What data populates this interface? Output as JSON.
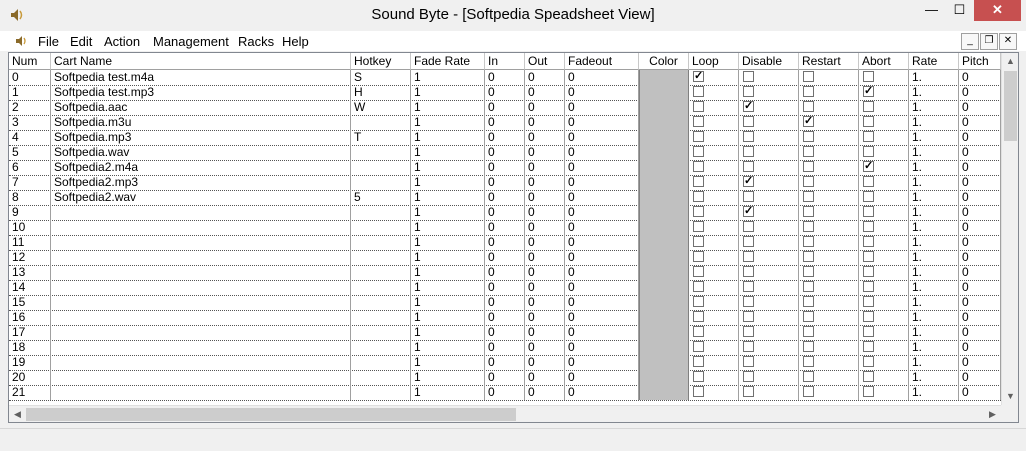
{
  "window": {
    "title": "Sound Byte - [Softpedia Speadsheet View]",
    "min": "—",
    "max": "☐",
    "close": "✕"
  },
  "menu": [
    "File",
    "Edit",
    "Action",
    "Management",
    "Racks",
    "Help"
  ],
  "mdi": {
    "min": "_",
    "restore": "❐",
    "close": "✕"
  },
  "columns": [
    "Num",
    "Cart Name",
    "Hotkey",
    "Fade Rate",
    "In",
    "Out",
    "Fadeout",
    "Color",
    "Loop",
    "Disable",
    "Restart",
    "Abort",
    "Rate",
    "Pitch"
  ],
  "rows": [
    {
      "num": "0",
      "name": "Softpedia test.m4a",
      "hotkey": "S",
      "fade": "1",
      "in": "0",
      "out": "0",
      "fadeout": "0",
      "loop": true,
      "disable": false,
      "restart": false,
      "abort": false,
      "rate": "1.",
      "pitch": "0"
    },
    {
      "num": "1",
      "name": "Softpedia test.mp3",
      "hotkey": "H",
      "fade": "1",
      "in": "0",
      "out": "0",
      "fadeout": "0",
      "loop": false,
      "disable": false,
      "restart": false,
      "abort": true,
      "rate": "1.",
      "pitch": "0"
    },
    {
      "num": "2",
      "name": "Softpedia.aac",
      "hotkey": "W",
      "fade": "1",
      "in": "0",
      "out": "0",
      "fadeout": "0",
      "loop": false,
      "disable": true,
      "restart": false,
      "abort": false,
      "rate": "1.",
      "pitch": "0"
    },
    {
      "num": "3",
      "name": "Softpedia.m3u",
      "hotkey": "",
      "fade": "1",
      "in": "0",
      "out": "0",
      "fadeout": "0",
      "loop": false,
      "disable": false,
      "restart": true,
      "abort": false,
      "rate": "1.",
      "pitch": "0"
    },
    {
      "num": "4",
      "name": "Softpedia.mp3",
      "hotkey": "T",
      "fade": "1",
      "in": "0",
      "out": "0",
      "fadeout": "0",
      "loop": false,
      "disable": false,
      "restart": false,
      "abort": false,
      "rate": "1.",
      "pitch": "0"
    },
    {
      "num": "5",
      "name": "Softpedia.wav",
      "hotkey": "",
      "fade": "1",
      "in": "0",
      "out": "0",
      "fadeout": "0",
      "loop": false,
      "disable": false,
      "restart": false,
      "abort": false,
      "rate": "1.",
      "pitch": "0"
    },
    {
      "num": "6",
      "name": "Softpedia2.m4a",
      "hotkey": "",
      "fade": "1",
      "in": "0",
      "out": "0",
      "fadeout": "0",
      "loop": false,
      "disable": false,
      "restart": false,
      "abort": true,
      "rate": "1.",
      "pitch": "0"
    },
    {
      "num": "7",
      "name": "Softpedia2.mp3",
      "hotkey": "",
      "fade": "1",
      "in": "0",
      "out": "0",
      "fadeout": "0",
      "loop": false,
      "disable": true,
      "restart": false,
      "abort": false,
      "rate": "1.",
      "pitch": "0"
    },
    {
      "num": "8",
      "name": "Softpedia2.wav",
      "hotkey": "5",
      "fade": "1",
      "in": "0",
      "out": "0",
      "fadeout": "0",
      "loop": false,
      "disable": false,
      "restart": false,
      "abort": false,
      "rate": "1.",
      "pitch": "0"
    },
    {
      "num": "9",
      "name": "",
      "hotkey": "",
      "fade": "1",
      "in": "0",
      "out": "0",
      "fadeout": "0",
      "loop": false,
      "disable": true,
      "restart": false,
      "abort": false,
      "rate": "1.",
      "pitch": "0"
    },
    {
      "num": "10",
      "name": "",
      "hotkey": "",
      "fade": "1",
      "in": "0",
      "out": "0",
      "fadeout": "0",
      "loop": false,
      "disable": false,
      "restart": false,
      "abort": false,
      "rate": "1.",
      "pitch": "0"
    },
    {
      "num": "11",
      "name": "",
      "hotkey": "",
      "fade": "1",
      "in": "0",
      "out": "0",
      "fadeout": "0",
      "loop": false,
      "disable": false,
      "restart": false,
      "abort": false,
      "rate": "1.",
      "pitch": "0"
    },
    {
      "num": "12",
      "name": "",
      "hotkey": "",
      "fade": "1",
      "in": "0",
      "out": "0",
      "fadeout": "0",
      "loop": false,
      "disable": false,
      "restart": false,
      "abort": false,
      "rate": "1.",
      "pitch": "0"
    },
    {
      "num": "13",
      "name": "",
      "hotkey": "",
      "fade": "1",
      "in": "0",
      "out": "0",
      "fadeout": "0",
      "loop": false,
      "disable": false,
      "restart": false,
      "abort": false,
      "rate": "1.",
      "pitch": "0"
    },
    {
      "num": "14",
      "name": "",
      "hotkey": "",
      "fade": "1",
      "in": "0",
      "out": "0",
      "fadeout": "0",
      "loop": false,
      "disable": false,
      "restart": false,
      "abort": false,
      "rate": "1.",
      "pitch": "0"
    },
    {
      "num": "15",
      "name": "",
      "hotkey": "",
      "fade": "1",
      "in": "0",
      "out": "0",
      "fadeout": "0",
      "loop": false,
      "disable": false,
      "restart": false,
      "abort": false,
      "rate": "1.",
      "pitch": "0"
    },
    {
      "num": "16",
      "name": "",
      "hotkey": "",
      "fade": "1",
      "in": "0",
      "out": "0",
      "fadeout": "0",
      "loop": false,
      "disable": false,
      "restart": false,
      "abort": false,
      "rate": "1.",
      "pitch": "0"
    },
    {
      "num": "17",
      "name": "",
      "hotkey": "",
      "fade": "1",
      "in": "0",
      "out": "0",
      "fadeout": "0",
      "loop": false,
      "disable": false,
      "restart": false,
      "abort": false,
      "rate": "1.",
      "pitch": "0"
    },
    {
      "num": "18",
      "name": "",
      "hotkey": "",
      "fade": "1",
      "in": "0",
      "out": "0",
      "fadeout": "0",
      "loop": false,
      "disable": false,
      "restart": false,
      "abort": false,
      "rate": "1.",
      "pitch": "0"
    },
    {
      "num": "19",
      "name": "",
      "hotkey": "",
      "fade": "1",
      "in": "0",
      "out": "0",
      "fadeout": "0",
      "loop": false,
      "disable": false,
      "restart": false,
      "abort": false,
      "rate": "1.",
      "pitch": "0"
    },
    {
      "num": "20",
      "name": "",
      "hotkey": "",
      "fade": "1",
      "in": "0",
      "out": "0",
      "fadeout": "0",
      "loop": false,
      "disable": false,
      "restart": false,
      "abort": false,
      "rate": "1.",
      "pitch": "0"
    },
    {
      "num": "21",
      "name": "",
      "hotkey": "",
      "fade": "1",
      "in": "0",
      "out": "0",
      "fadeout": "0",
      "loop": false,
      "disable": false,
      "restart": false,
      "abort": false,
      "rate": "1.",
      "pitch": "0"
    }
  ],
  "colors": {
    "color_cell": "#c0c0c0",
    "close_button": "#c75050"
  },
  "icons": {
    "app": "speaker-icon",
    "scroll_up": "▲",
    "scroll_down": "▼",
    "scroll_left": "◀",
    "scroll_right": "▶"
  }
}
